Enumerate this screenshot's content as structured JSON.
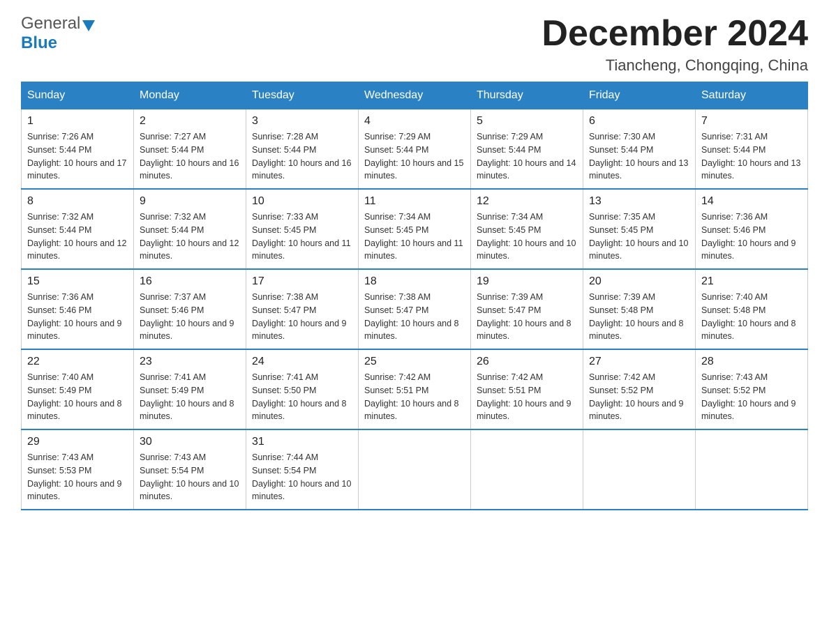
{
  "header": {
    "month_title": "December 2024",
    "location": "Tiancheng, Chongqing, China",
    "logo_general": "General",
    "logo_blue": "Blue"
  },
  "days_of_week": [
    "Sunday",
    "Monday",
    "Tuesday",
    "Wednesday",
    "Thursday",
    "Friday",
    "Saturday"
  ],
  "weeks": [
    [
      {
        "day": "1",
        "sunrise": "7:26 AM",
        "sunset": "5:44 PM",
        "daylight": "10 hours and 17 minutes."
      },
      {
        "day": "2",
        "sunrise": "7:27 AM",
        "sunset": "5:44 PM",
        "daylight": "10 hours and 16 minutes."
      },
      {
        "day": "3",
        "sunrise": "7:28 AM",
        "sunset": "5:44 PM",
        "daylight": "10 hours and 16 minutes."
      },
      {
        "day": "4",
        "sunrise": "7:29 AM",
        "sunset": "5:44 PM",
        "daylight": "10 hours and 15 minutes."
      },
      {
        "day": "5",
        "sunrise": "7:29 AM",
        "sunset": "5:44 PM",
        "daylight": "10 hours and 14 minutes."
      },
      {
        "day": "6",
        "sunrise": "7:30 AM",
        "sunset": "5:44 PM",
        "daylight": "10 hours and 13 minutes."
      },
      {
        "day": "7",
        "sunrise": "7:31 AM",
        "sunset": "5:44 PM",
        "daylight": "10 hours and 13 minutes."
      }
    ],
    [
      {
        "day": "8",
        "sunrise": "7:32 AM",
        "sunset": "5:44 PM",
        "daylight": "10 hours and 12 minutes."
      },
      {
        "day": "9",
        "sunrise": "7:32 AM",
        "sunset": "5:44 PM",
        "daylight": "10 hours and 12 minutes."
      },
      {
        "day": "10",
        "sunrise": "7:33 AM",
        "sunset": "5:45 PM",
        "daylight": "10 hours and 11 minutes."
      },
      {
        "day": "11",
        "sunrise": "7:34 AM",
        "sunset": "5:45 PM",
        "daylight": "10 hours and 11 minutes."
      },
      {
        "day": "12",
        "sunrise": "7:34 AM",
        "sunset": "5:45 PM",
        "daylight": "10 hours and 10 minutes."
      },
      {
        "day": "13",
        "sunrise": "7:35 AM",
        "sunset": "5:45 PM",
        "daylight": "10 hours and 10 minutes."
      },
      {
        "day": "14",
        "sunrise": "7:36 AM",
        "sunset": "5:46 PM",
        "daylight": "10 hours and 9 minutes."
      }
    ],
    [
      {
        "day": "15",
        "sunrise": "7:36 AM",
        "sunset": "5:46 PM",
        "daylight": "10 hours and 9 minutes."
      },
      {
        "day": "16",
        "sunrise": "7:37 AM",
        "sunset": "5:46 PM",
        "daylight": "10 hours and 9 minutes."
      },
      {
        "day": "17",
        "sunrise": "7:38 AM",
        "sunset": "5:47 PM",
        "daylight": "10 hours and 9 minutes."
      },
      {
        "day": "18",
        "sunrise": "7:38 AM",
        "sunset": "5:47 PM",
        "daylight": "10 hours and 8 minutes."
      },
      {
        "day": "19",
        "sunrise": "7:39 AM",
        "sunset": "5:47 PM",
        "daylight": "10 hours and 8 minutes."
      },
      {
        "day": "20",
        "sunrise": "7:39 AM",
        "sunset": "5:48 PM",
        "daylight": "10 hours and 8 minutes."
      },
      {
        "day": "21",
        "sunrise": "7:40 AM",
        "sunset": "5:48 PM",
        "daylight": "10 hours and 8 minutes."
      }
    ],
    [
      {
        "day": "22",
        "sunrise": "7:40 AM",
        "sunset": "5:49 PM",
        "daylight": "10 hours and 8 minutes."
      },
      {
        "day": "23",
        "sunrise": "7:41 AM",
        "sunset": "5:49 PM",
        "daylight": "10 hours and 8 minutes."
      },
      {
        "day": "24",
        "sunrise": "7:41 AM",
        "sunset": "5:50 PM",
        "daylight": "10 hours and 8 minutes."
      },
      {
        "day": "25",
        "sunrise": "7:42 AM",
        "sunset": "5:51 PM",
        "daylight": "10 hours and 8 minutes."
      },
      {
        "day": "26",
        "sunrise": "7:42 AM",
        "sunset": "5:51 PM",
        "daylight": "10 hours and 9 minutes."
      },
      {
        "day": "27",
        "sunrise": "7:42 AM",
        "sunset": "5:52 PM",
        "daylight": "10 hours and 9 minutes."
      },
      {
        "day": "28",
        "sunrise": "7:43 AM",
        "sunset": "5:52 PM",
        "daylight": "10 hours and 9 minutes."
      }
    ],
    [
      {
        "day": "29",
        "sunrise": "7:43 AM",
        "sunset": "5:53 PM",
        "daylight": "10 hours and 9 minutes."
      },
      {
        "day": "30",
        "sunrise": "7:43 AM",
        "sunset": "5:54 PM",
        "daylight": "10 hours and 10 minutes."
      },
      {
        "day": "31",
        "sunrise": "7:44 AM",
        "sunset": "5:54 PM",
        "daylight": "10 hours and 10 minutes."
      },
      null,
      null,
      null,
      null
    ]
  ],
  "colors": {
    "header_bg": "#2a82c5",
    "header_text": "#ffffff",
    "border_accent": "#2a82c5"
  }
}
